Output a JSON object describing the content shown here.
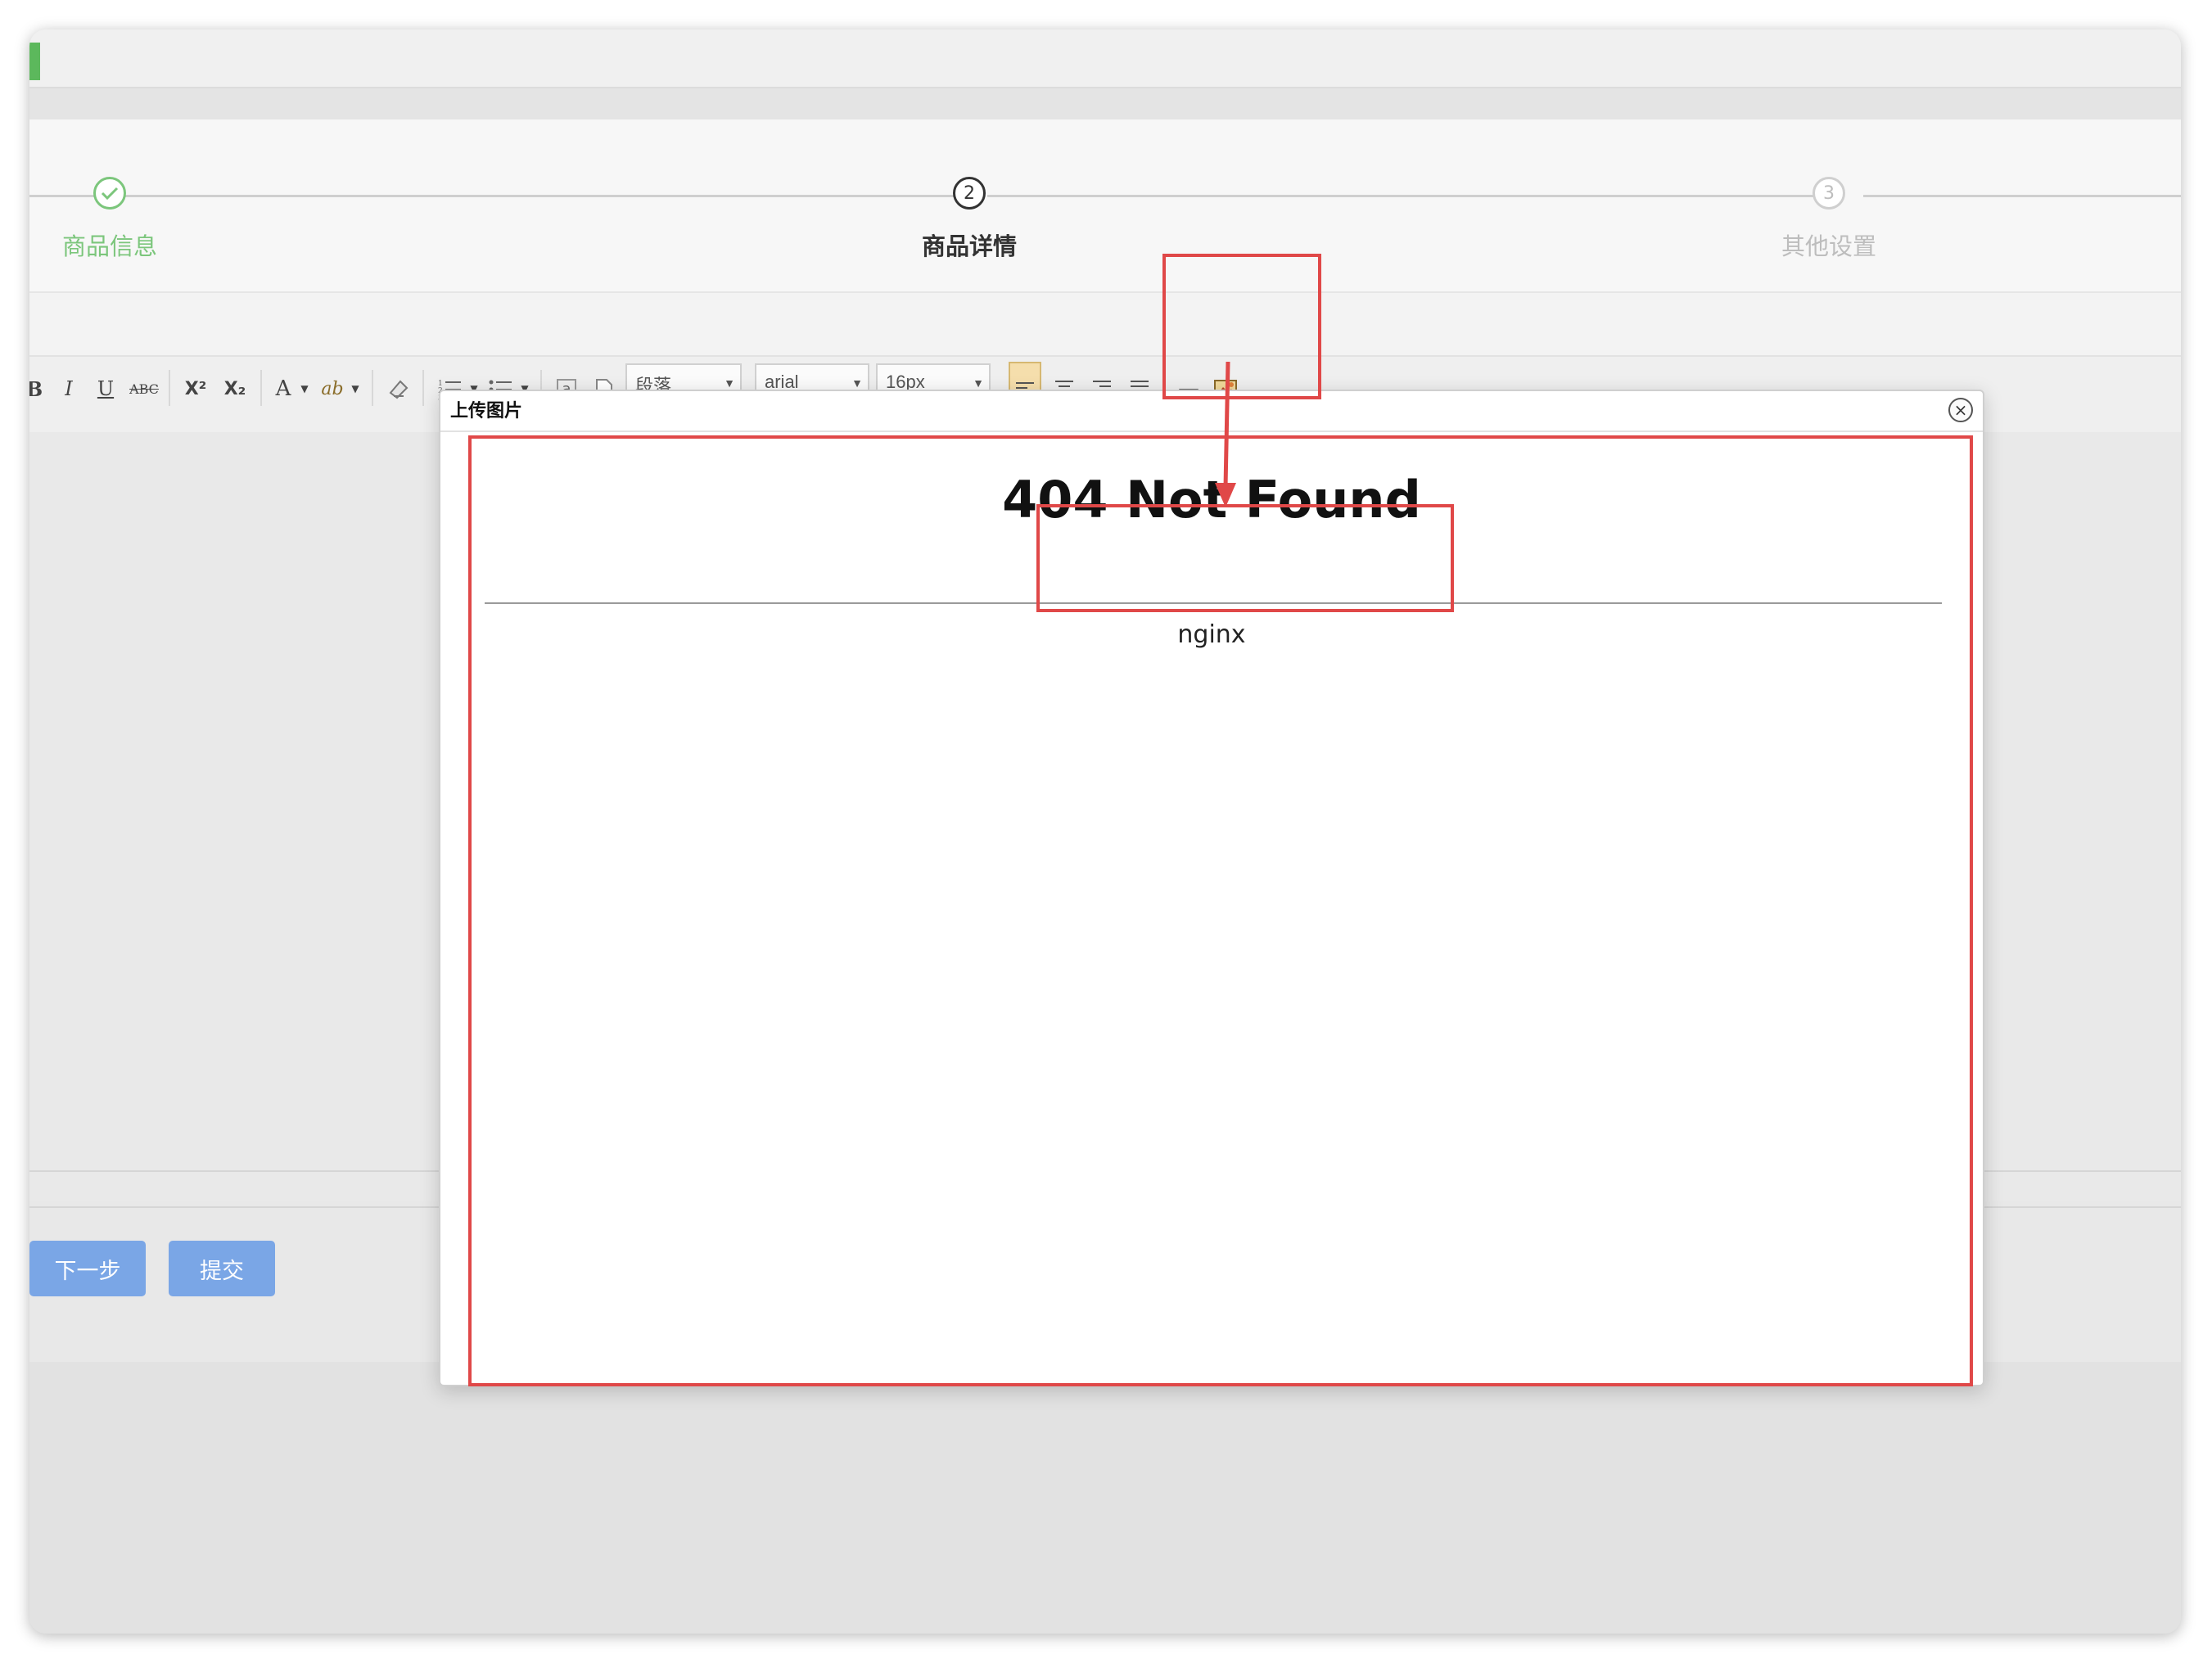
{
  "steps": [
    {
      "label": "商品信息",
      "state": "done"
    },
    {
      "label": "商品详情",
      "state": "active",
      "number": "2"
    },
    {
      "label": "其他设置",
      "state": "pending",
      "number": "3"
    }
  ],
  "toolbar": {
    "bold": "B",
    "italic": "I",
    "underline": "U",
    "strikethrough": "ABC",
    "superscript": "X²",
    "subscript": "X₂",
    "font_color": "A",
    "highlight": "ab",
    "paragraph": "段落",
    "font_family": "arial",
    "font_size": "16px",
    "insert_anchor": "a",
    "horizontal_rule": "—"
  },
  "buttons": {
    "next": "下一步",
    "submit": "提交"
  },
  "dialog": {
    "title": "上传图片",
    "close": "×",
    "error_heading": "404 Not Found",
    "server": "nginx"
  },
  "colors": {
    "step_done": "#7cc67c",
    "button_blue": "#7aa6e6",
    "annotation_red": "#e04848"
  }
}
